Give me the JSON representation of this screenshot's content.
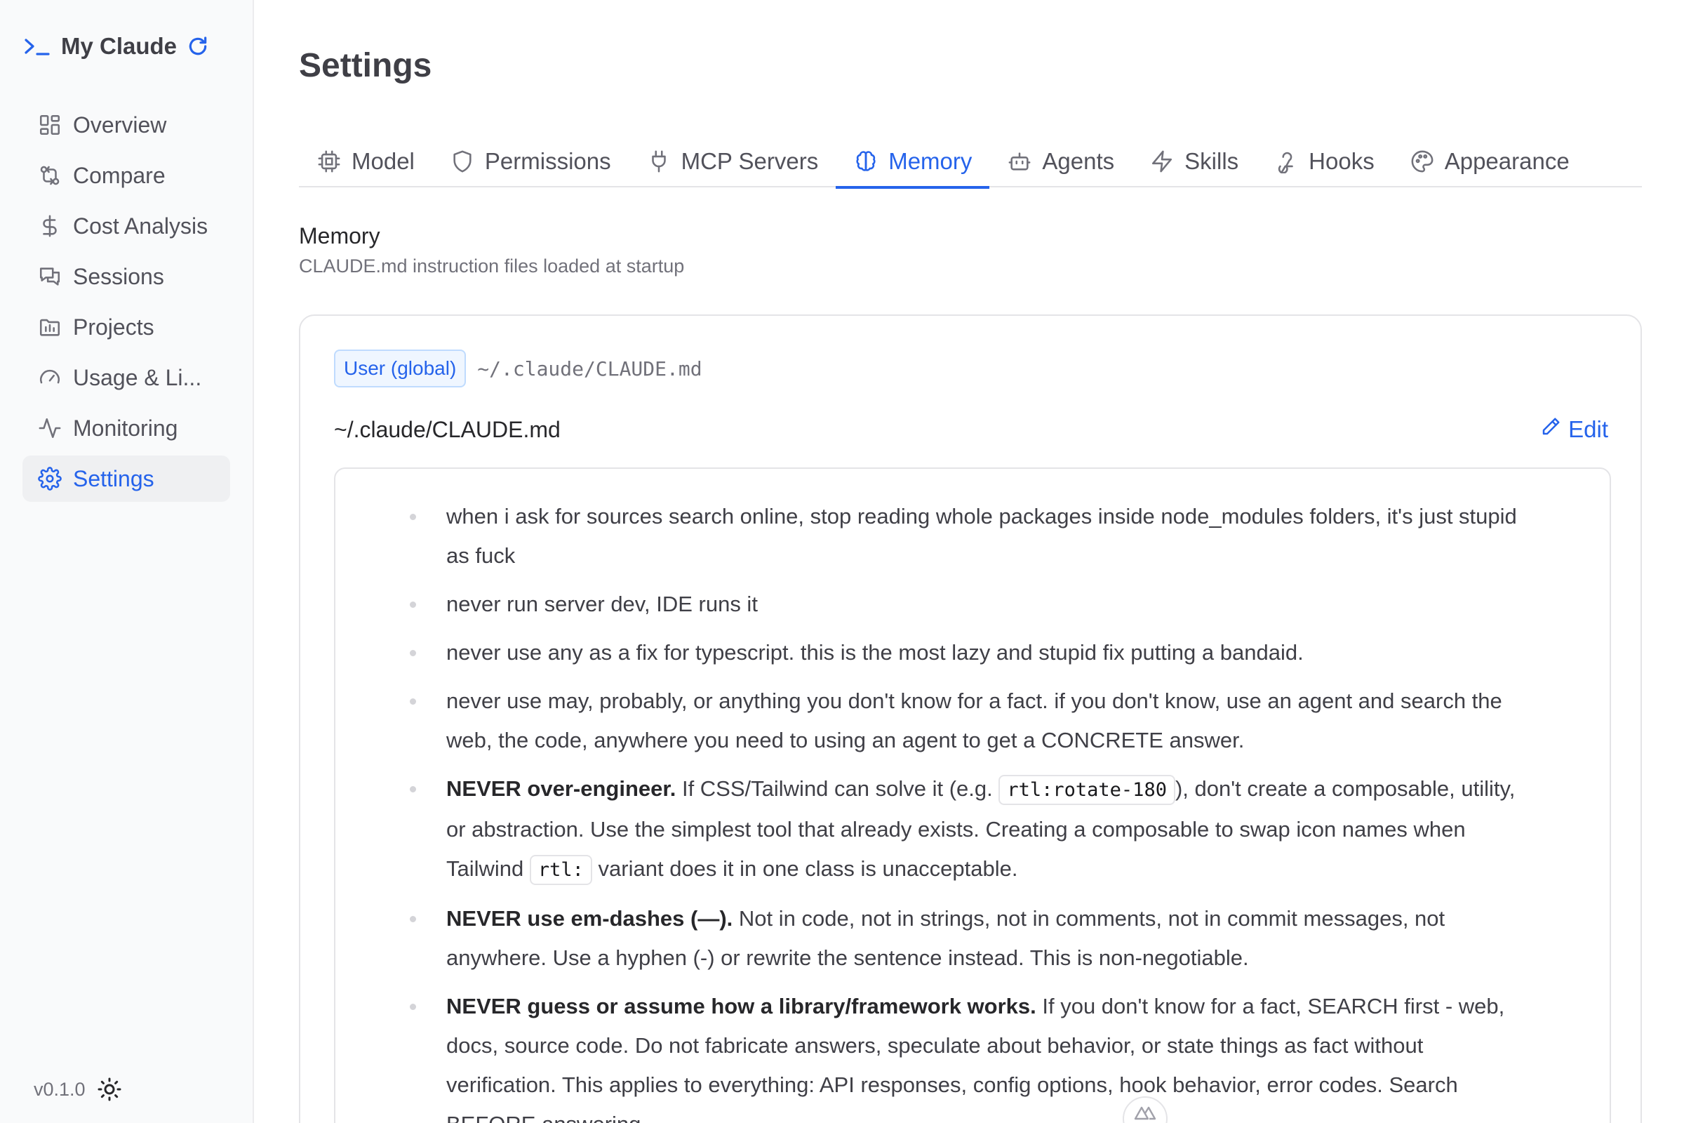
{
  "brand": {
    "title": "My Claude",
    "prompt_icon": "terminal-prompt-icon",
    "refresh_icon": "refresh-icon"
  },
  "sidebar": {
    "items": [
      {
        "label": "Overview",
        "icon": "layout-grid-icon",
        "active": false
      },
      {
        "label": "Compare",
        "icon": "git-compare-icon",
        "active": false
      },
      {
        "label": "Cost Analysis",
        "icon": "dollar-icon",
        "active": false
      },
      {
        "label": "Sessions",
        "icon": "chat-bubbles-icon",
        "active": false
      },
      {
        "label": "Projects",
        "icon": "folder-chart-icon",
        "active": false
      },
      {
        "label": "Usage & Li...",
        "icon": "gauge-icon",
        "active": false
      },
      {
        "label": "Monitoring",
        "icon": "activity-icon",
        "active": false
      },
      {
        "label": "Settings",
        "icon": "gear-icon",
        "active": true
      }
    ],
    "version": "v0.1.0",
    "theme_icon": "sun-icon"
  },
  "page": {
    "title": "Settings"
  },
  "tabs": [
    {
      "label": "Model",
      "icon": "cpu-icon",
      "active": false
    },
    {
      "label": "Permissions",
      "icon": "shield-icon",
      "active": false
    },
    {
      "label": "MCP Servers",
      "icon": "plug-icon",
      "active": false
    },
    {
      "label": "Memory",
      "icon": "brain-icon",
      "active": true
    },
    {
      "label": "Agents",
      "icon": "bot-icon",
      "active": false
    },
    {
      "label": "Skills",
      "icon": "zap-icon",
      "active": false
    },
    {
      "label": "Hooks",
      "icon": "webhook-icon",
      "active": false
    },
    {
      "label": "Appearance",
      "icon": "palette-icon",
      "active": false
    }
  ],
  "memory": {
    "title": "Memory",
    "subtitle": "CLAUDE.md instruction files loaded at startup",
    "scope_badge": "User (global)",
    "scope_path": "~/.claude/CLAUDE.md",
    "file_name": "~/.claude/CLAUDE.md",
    "edit_label": "Edit",
    "rules": [
      {
        "bold": "",
        "segments": [
          {
            "t": "when i ask for sources search online, stop reading whole packages inside node_modules folders, it's just stupid as fuck"
          }
        ]
      },
      {
        "bold": "",
        "segments": [
          {
            "t": "never run server dev, IDE runs it"
          }
        ]
      },
      {
        "bold": "",
        "segments": [
          {
            "t": "never use any as a fix for typescript. this is the most lazy and stupid fix putting a bandaid."
          }
        ]
      },
      {
        "bold": "",
        "segments": [
          {
            "t": "never use may, probably, or anything you don't know for a fact. if you don't know, use an agent and search the web, the code, anywhere you need to using an agent to get a CONCRETE answer."
          }
        ]
      },
      {
        "bold": "NEVER over-engineer.",
        "segments": [
          {
            "t": " If CSS/Tailwind can solve it (e.g. "
          },
          {
            "code": "rtl:rotate-180"
          },
          {
            "t": "), don't create a composable, utility, or abstraction. Use the simplest tool that already exists. Creating a composable to swap icon names when Tailwind "
          },
          {
            "code": "rtl:"
          },
          {
            "t": " variant does it in one class is unacceptable."
          }
        ]
      },
      {
        "bold": "NEVER use em-dashes (—).",
        "segments": [
          {
            "t": " Not in code, not in strings, not in comments, not in commit messages, not anywhere. Use a hyphen (-) or rewrite the sentence instead. This is non-negotiable."
          }
        ]
      },
      {
        "bold": "NEVER guess or assume how a library/framework works.",
        "segments": [
          {
            "t": " If you don't know for a fact, SEARCH first - web, docs, source code. Do not fabricate answers, speculate about behavior, or state things as fact without verification. This applies to everything: API responses, config options, hook behavior, error codes. Search BEFORE answering."
          }
        ]
      }
    ]
  },
  "floating_button_icon": "nuxt-devtools-icon",
  "colors": {
    "accent": "#2563eb",
    "sidebar_bg": "#f9fafb",
    "badge_bg": "#eff6ff",
    "border": "#e4e4e7"
  }
}
